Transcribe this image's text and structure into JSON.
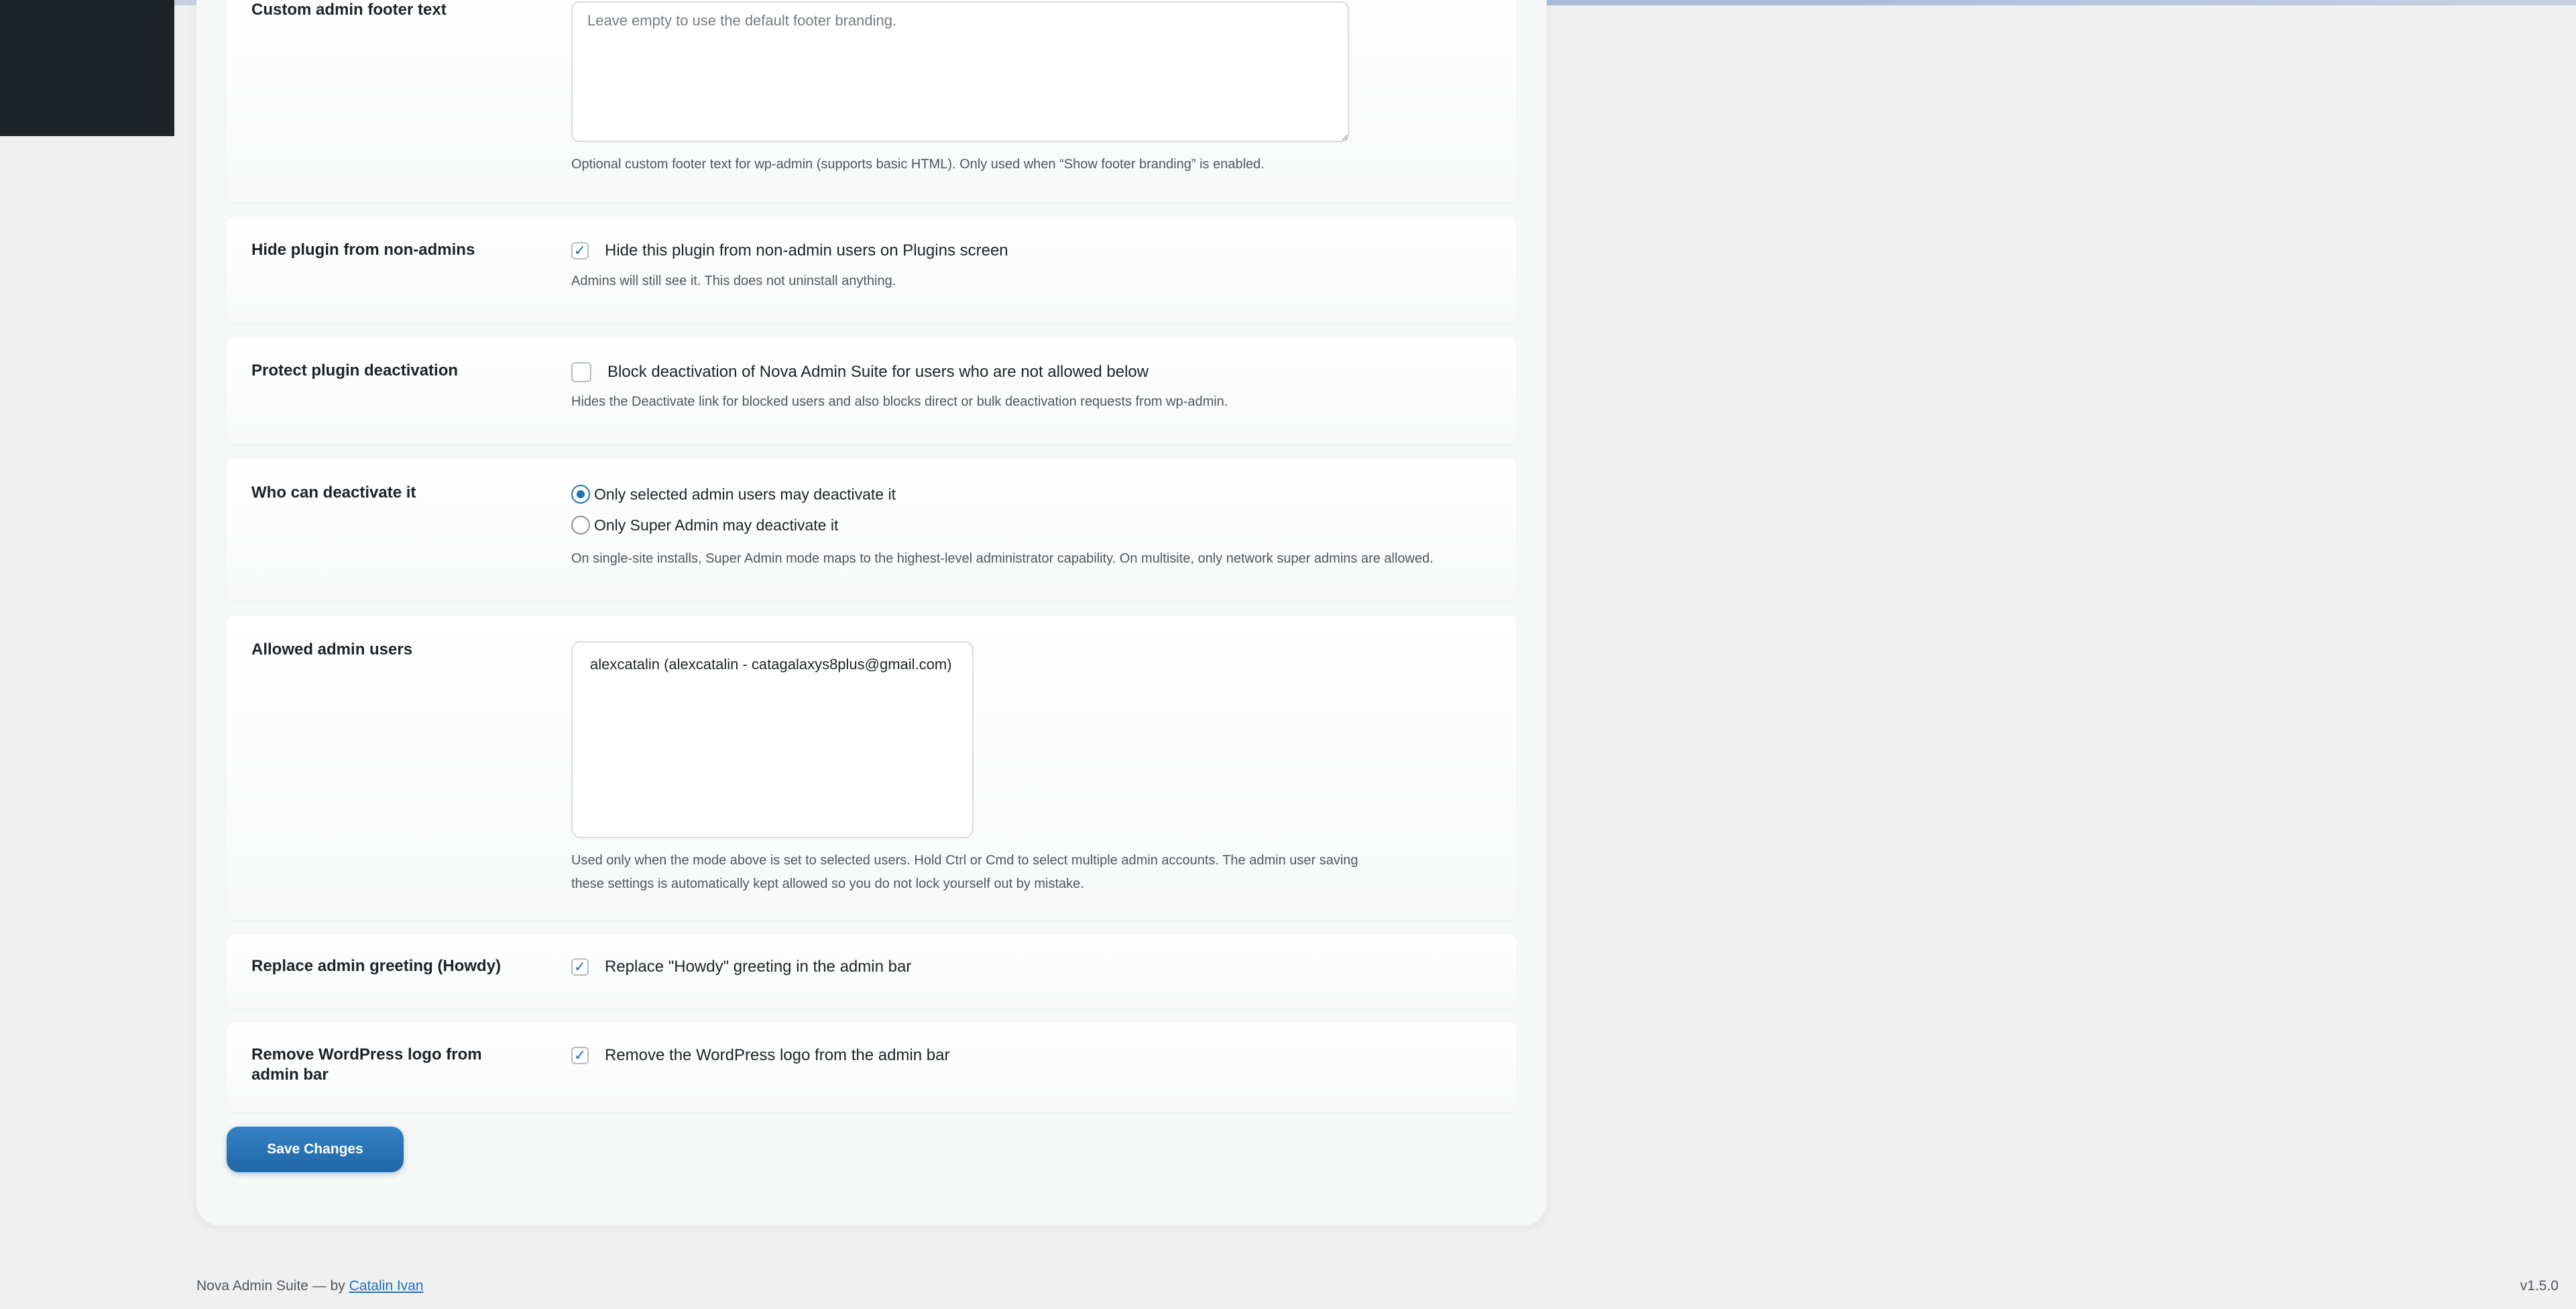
{
  "settings": {
    "footer_text": {
      "label": "Custom admin footer text",
      "placeholder": "Leave empty to use the default footer branding.",
      "value": "",
      "description": "Optional custom footer text for wp-admin (supports basic HTML). Only used when “Show footer branding” is enabled."
    },
    "hide_plugin": {
      "label": "Hide plugin from non-admins",
      "checkbox_label": "Hide this plugin from non-admin users on Plugins screen",
      "checked": true,
      "description": "Admins will still see it. This does not uninstall anything."
    },
    "protect_deactivation": {
      "label": "Protect plugin deactivation",
      "checkbox_label": "Block deactivation of Nova Admin Suite for users who are not allowed below",
      "checked": false,
      "description": "Hides the Deactivate link for blocked users and also blocks direct or bulk deactivation requests from wp-admin."
    },
    "who_can_deactivate": {
      "label": "Who can deactivate it",
      "options": [
        {
          "label": "Only selected admin users may deactivate it",
          "selected": true
        },
        {
          "label": "Only Super Admin may deactivate it",
          "selected": false
        }
      ],
      "description": "On single-site installs, Super Admin mode maps to the highest-level administrator capability. On multisite, only network super admins are allowed."
    },
    "allowed_users": {
      "label": "Allowed admin users",
      "options": [
        "alexcatalin (alexcatalin - catagalaxys8plus@gmail.com)"
      ],
      "description": "Used only when the mode above is set to selected users. Hold Ctrl or Cmd to select multiple admin accounts. The admin user saving these settings is automatically kept allowed so you do not lock yourself out by mistake."
    },
    "replace_howdy": {
      "label": "Replace admin greeting (Howdy)",
      "checkbox_label": "Replace \"Howdy\" greeting in the admin bar",
      "checked": true
    },
    "remove_wp_logo": {
      "label": "Remove WordPress logo from admin bar",
      "checkbox_label": "Remove the WordPress logo from the admin bar",
      "checked": true
    }
  },
  "save_button": "Save Changes",
  "footer": {
    "credit_prefix": "Nova Admin Suite — by",
    "author_link": "Catalin Ivan",
    "version": "v1.5.0"
  },
  "colors": {
    "accent": "#2271b1",
    "background": "#f0f0f1",
    "admin_menu": "#1d2327"
  },
  "icons": {
    "checkmark": "check-icon"
  }
}
